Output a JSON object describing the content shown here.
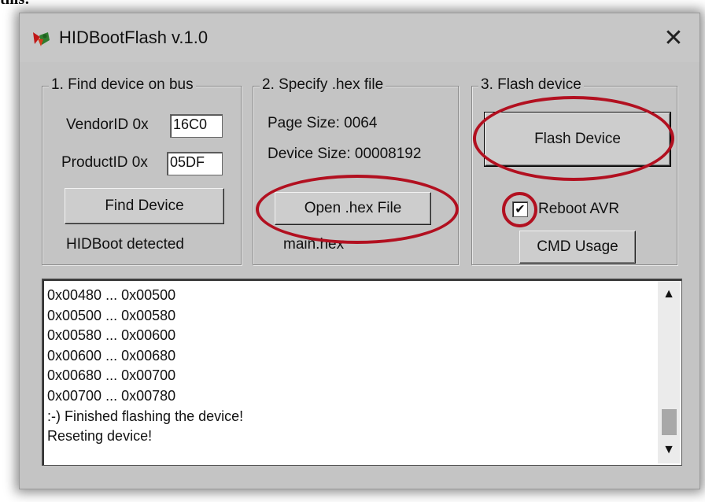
{
  "page_fragment": "this:",
  "window": {
    "title": "HIDBootFlash v.1.0",
    "close_glyph": "✕",
    "app_icon": "app-icon"
  },
  "group1": {
    "legend": "1. Find device on bus",
    "vendor_label": "VendorID 0x",
    "vendor_value": "16C0",
    "product_label": "ProductID 0x",
    "product_value": "05DF",
    "find_button": "Find Device",
    "status": "HIDBoot detected"
  },
  "group2": {
    "legend": "2. Specify .hex file",
    "page_size": "Page Size: 0064",
    "device_size": "Device Size: 00008192",
    "open_button": "Open .hex File",
    "file_name": "main.hex"
  },
  "group3": {
    "legend": "3. Flash device",
    "flash_button": "Flash Device",
    "reboot_label": "Reboot AVR",
    "reboot_checked": true,
    "reboot_check_glyph": "✔",
    "cmd_button": "CMD Usage"
  },
  "log": {
    "lines": [
      "0x00480 ... 0x00500",
      "0x00500 ... 0x00580",
      "0x00580 ... 0x00600",
      "0x00600 ... 0x00680",
      "0x00680 ... 0x00700",
      "0x00700 ... 0x00780",
      ":-) Finished flashing the device!",
      "Reseting device!"
    ],
    "scroll_up_glyph": "▲",
    "scroll_down_glyph": "▼"
  },
  "colors": {
    "annotation_red": "#b21020",
    "window_bg": "#c4c4c4"
  }
}
